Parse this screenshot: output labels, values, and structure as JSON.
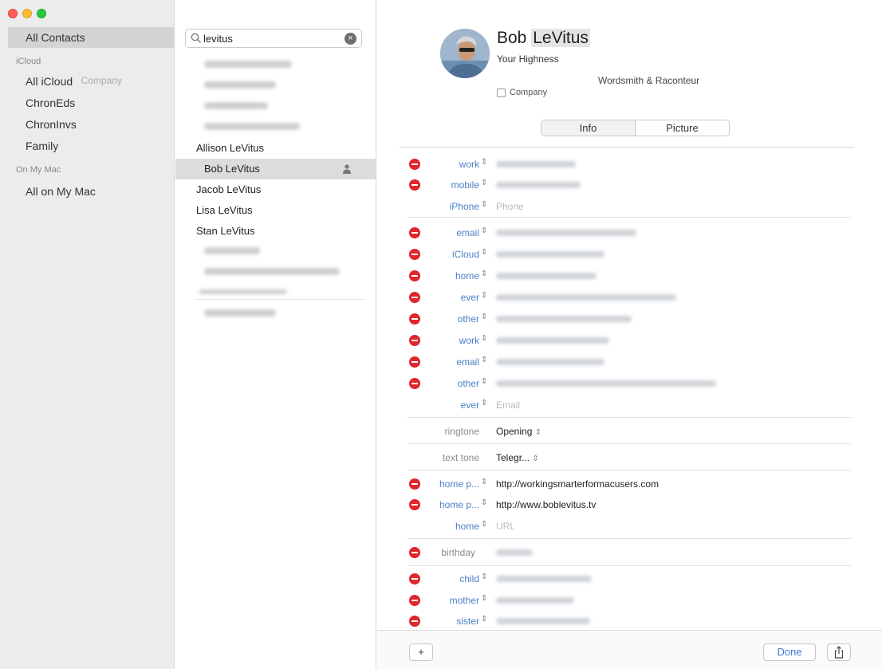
{
  "window": {
    "controls": [
      "close",
      "minimize",
      "zoom"
    ]
  },
  "sidebar": {
    "selected": "All Contacts",
    "sections": [
      {
        "header": "",
        "items": [
          "All Contacts"
        ]
      },
      {
        "header": "iCloud",
        "items": [
          "All iCloud",
          "ChronEds",
          "ChronInvs",
          "Family"
        ]
      },
      {
        "header": "On My Mac",
        "items": [
          "All on My Mac"
        ]
      }
    ]
  },
  "list": {
    "search_value": "levitus",
    "contacts": [
      "Allison LeVitus",
      "Bob LeVitus",
      "Jacob LeVitus",
      "Lisa LeVitus",
      "Stan LeVitus"
    ],
    "selected": "Bob LeVitus"
  },
  "detail": {
    "name_first": "Bob",
    "name_last": "LeVitus",
    "nickname": "Your Highness",
    "company_label": "Company",
    "company_value": "Wordsmith & Raconteur",
    "company_checkbox_label": "Company",
    "tabs": [
      "Info",
      "Picture"
    ],
    "phones": [
      {
        "label": "work",
        "removable": true
      },
      {
        "label": "mobile",
        "removable": true
      },
      {
        "label": "iPhone",
        "placeholder": "Phone",
        "removable": false
      }
    ],
    "emails": [
      {
        "label": "email"
      },
      {
        "label": "iCloud"
      },
      {
        "label": "home"
      },
      {
        "label": "ever"
      },
      {
        "label": "other"
      },
      {
        "label": "work"
      },
      {
        "label": "email"
      },
      {
        "label": "other"
      },
      {
        "label": "ever",
        "placeholder": "Email"
      }
    ],
    "ringtone_label": "ringtone",
    "ringtone_value": "Opening",
    "texttone_label": "text tone",
    "texttone_value": "Telegr...",
    "urls": [
      {
        "label": "home p...",
        "value": "http://workingsmarterformacusers.com"
      },
      {
        "label": "home p...",
        "value": "http://www.boblevitus.tv"
      },
      {
        "label": "home",
        "placeholder": "URL"
      }
    ],
    "birthday_label": "birthday",
    "relations": [
      {
        "label": "child"
      },
      {
        "label": "mother"
      },
      {
        "label": "sister"
      }
    ]
  },
  "bottombar": {
    "add_label": "+",
    "done_label": "Done"
  },
  "colors": {
    "remove": "#e0262e",
    "label_blue": "#4a7fc7",
    "sidebar_bg": "#ececec"
  }
}
